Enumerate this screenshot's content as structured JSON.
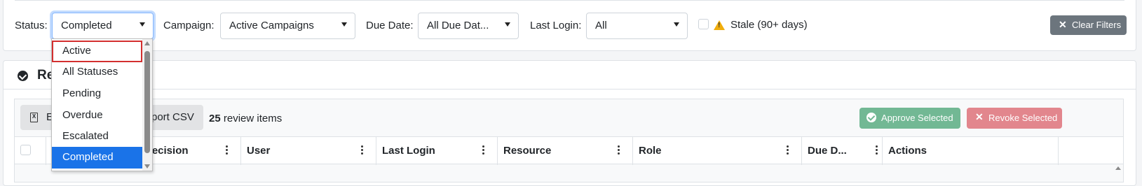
{
  "filters": {
    "status_label": "Status:",
    "status_value": "Completed",
    "campaign_label": "Campaign:",
    "campaign_value": "Active Campaigns",
    "due_date_label": "Due Date:",
    "due_date_value": "All Due Dat...",
    "last_login_label": "Last Login:",
    "last_login_value": "All",
    "stale_label": "Stale (90+ days)",
    "clear_button": "Clear Filters"
  },
  "status_dropdown": {
    "options": [
      "Active",
      "All Statuses",
      "Pending",
      "Overdue",
      "Escalated",
      "Completed"
    ],
    "hovered": "Active",
    "selected": "Completed"
  },
  "section": {
    "title": "Rev"
  },
  "toolbar": {
    "export_excel_label": "E",
    "export_csv_label": "port CSV",
    "count_number": "25",
    "count_suffix": "review items",
    "approve_button": "Approve Selected",
    "revoke_button": "Revoke Selected"
  },
  "table": {
    "columns": [
      "",
      "Decision",
      "User",
      "Last Login",
      "Resource",
      "Role",
      "Due D...",
      "Actions"
    ]
  },
  "colors": {
    "selected_option": "#1a73e8",
    "hover_outline": "#d32f2f",
    "approve": "#72b894",
    "revoke": "#e2868d",
    "clear": "#6c757d",
    "warning": "#f0ad0c"
  }
}
